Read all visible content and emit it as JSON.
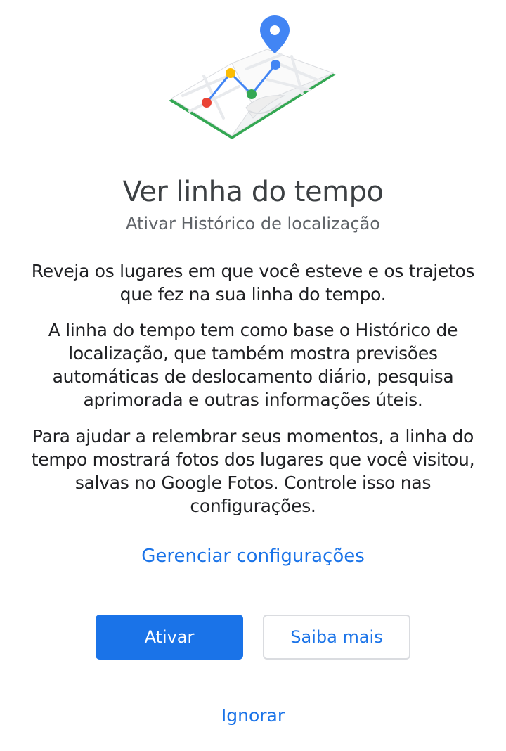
{
  "illustration": {
    "icon": "map-timeline-icon",
    "colors": {
      "pin": "#4285f4",
      "red_dot": "#ea4335",
      "yellow_dot": "#fbbc04",
      "green_dot": "#34a853",
      "blue_dot": "#4285f4",
      "map_border": "#34a853"
    }
  },
  "header": {
    "title": "Ver linha do tempo",
    "subtitle": "Ativar Histórico de localização"
  },
  "body": {
    "paragraph1": "Reveja os lugares em que você esteve e os trajetos que fez na sua linha do tempo.",
    "paragraph2": "A linha do tempo tem como base o Histórico de localização, que também mostra previsões automáticas de deslocamento diário, pesquisa aprimorada e outras informações úteis.",
    "paragraph3": "Para ajudar a relembrar seus momentos, a linha do tempo mostrará fotos dos lugares que você visitou, salvas no Google Fotos. Controle isso nas configurações."
  },
  "actions": {
    "manage_label": "Gerenciar configurações",
    "enable_label": "Ativar",
    "learn_more_label": "Saiba mais",
    "ignore_label": "Ignorar"
  },
  "theme": {
    "accent": "#1a73e8",
    "text_primary": "#202124",
    "text_secondary": "#5f6368"
  }
}
